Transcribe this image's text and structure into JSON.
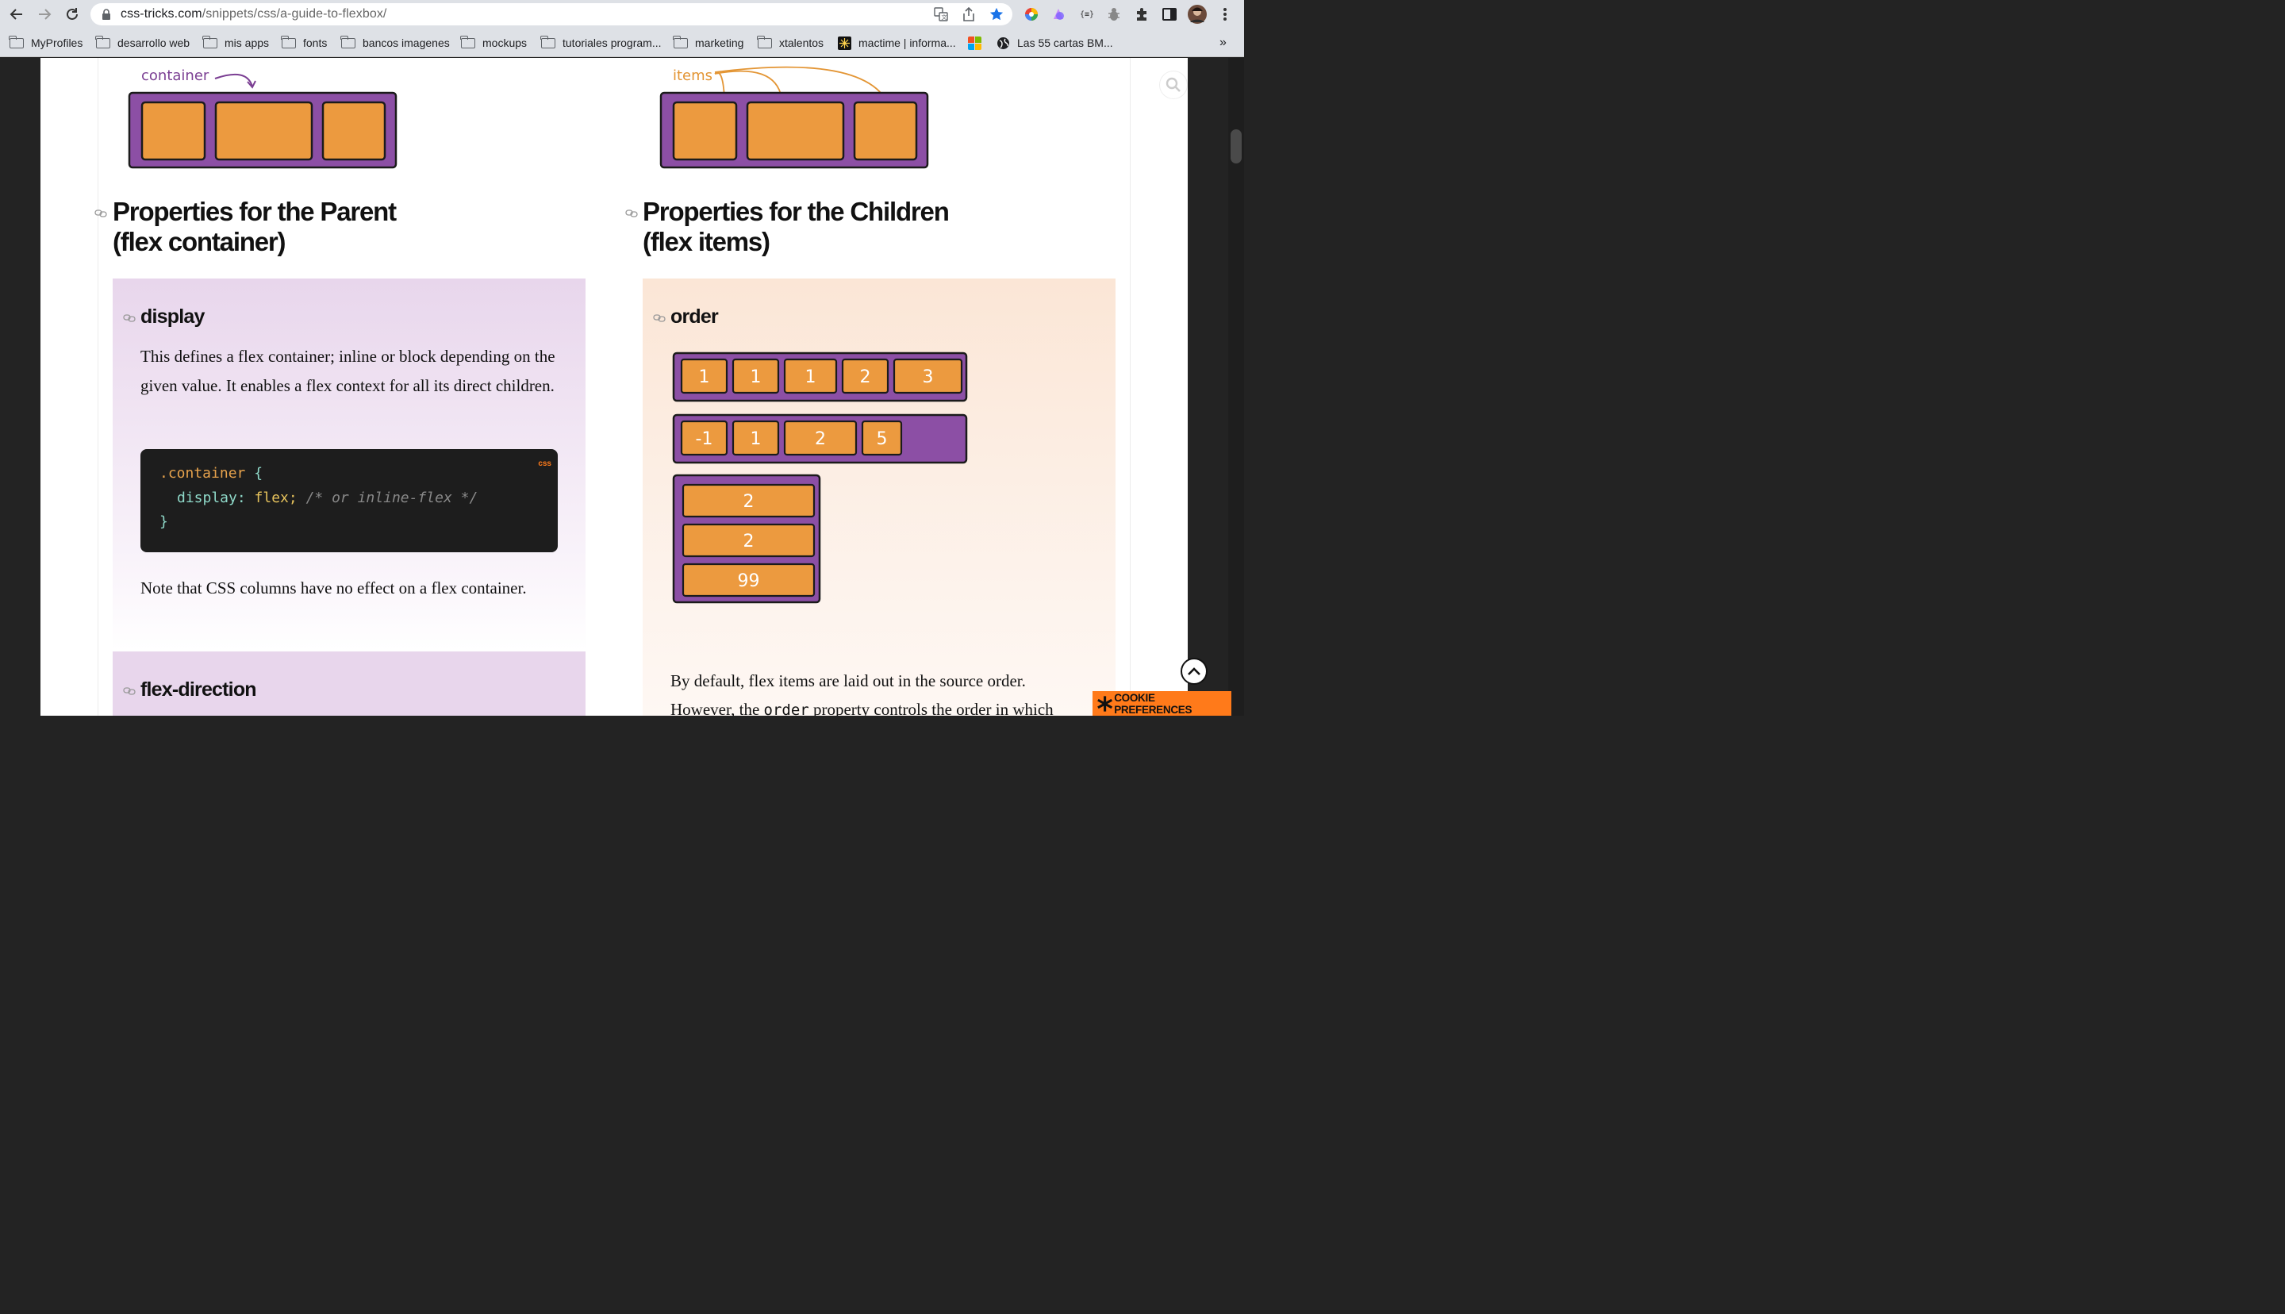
{
  "browser": {
    "url_host": "css-tricks.com",
    "url_path": "/snippets/css/a-guide-to-flexbox/",
    "bookmarks": [
      {
        "label": "MyProfiles"
      },
      {
        "label": "desarrollo web"
      },
      {
        "label": "mis apps"
      },
      {
        "label": "fonts"
      },
      {
        "label": "bancos imagenes"
      },
      {
        "label": "mockups"
      },
      {
        "label": "tutoriales program..."
      },
      {
        "label": "marketing"
      },
      {
        "label": "xtalentos"
      },
      {
        "label": "mactime | informa..."
      },
      {
        "label": "Las 55 cartas BM..."
      }
    ],
    "overflow_label": "»",
    "ext_label": "{≡}"
  },
  "illustrations": {
    "container_label": "container",
    "items_label": "items"
  },
  "parent": {
    "heading_line1": "Properties for the Parent",
    "heading_line2": "(flex container)",
    "display": {
      "title": "display",
      "description": "This defines a flex container; inline or block depending on the given value. It enables a flex context for all its direct children.",
      "code_lang": "css",
      "code": {
        "selector": ".container",
        "open": "{",
        "property": "display:",
        "value": "flex;",
        "comment": "/* or inline-flex */",
        "close": "}"
      },
      "note": "Note that CSS columns have no effect on a flex container."
    },
    "next_title": "flex-direction"
  },
  "children": {
    "heading_line1": "Properties for the Children",
    "heading_line2": "(flex items)",
    "order": {
      "title": "order",
      "row1": [
        "1",
        "1",
        "1",
        "2",
        "3"
      ],
      "row2": [
        "-1",
        "1",
        "2",
        "5"
      ],
      "column": [
        "2",
        "2",
        "99"
      ],
      "desc_line1": "By default, flex items are laid out in the source order.",
      "desc_line2_pre": "However, the",
      "desc_line2_code": "order",
      "desc_line2_post": "property controls the order in which"
    }
  },
  "ui": {
    "cookie_label": "COOKIE PREFERENCES"
  },
  "colors": {
    "purple": "#8c4fa5",
    "orange": "#ec9a3f",
    "code_bg": "#1d1d1d",
    "cookie": "#ff7a1a"
  }
}
